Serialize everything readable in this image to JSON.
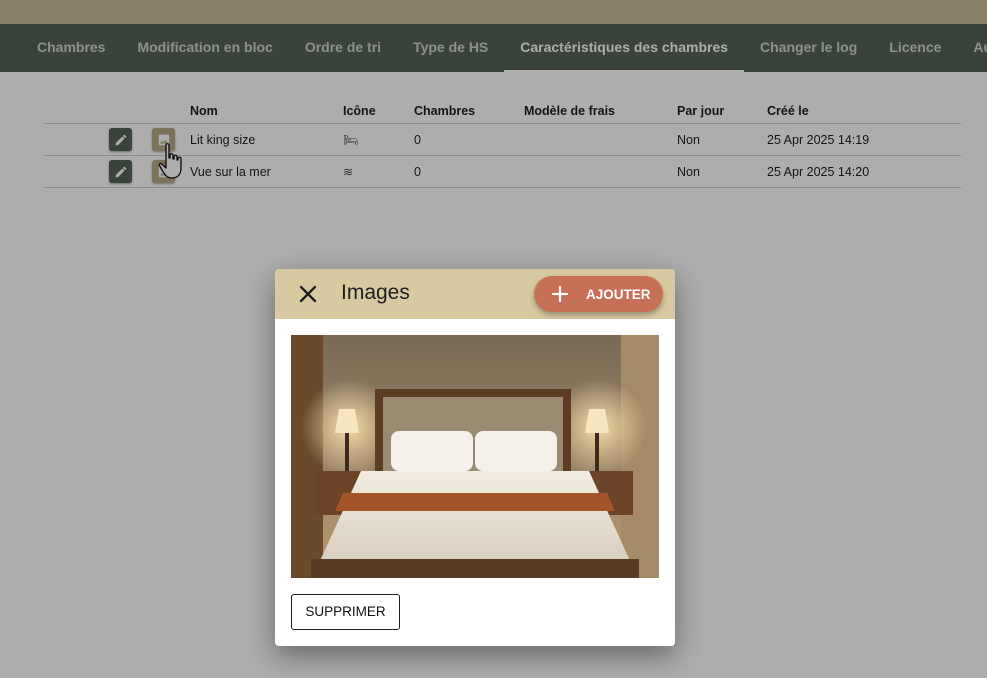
{
  "tabs": [
    {
      "label": "Chambres"
    },
    {
      "label": "Modification en bloc"
    },
    {
      "label": "Ordre de tri"
    },
    {
      "label": "Type de HS"
    },
    {
      "label": "Caractéristiques des chambres"
    },
    {
      "label": "Changer le log"
    },
    {
      "label": "Licence"
    },
    {
      "label": "Autre"
    }
  ],
  "active_tab": "Caractéristiques des chambres",
  "table": {
    "columns": [
      "Nom",
      "Icône",
      "Chambres",
      "Modèle de frais",
      "Par jour",
      "Créé le"
    ],
    "rows": [
      {
        "name": "Lit king size",
        "icon": "bed-icon",
        "icon_glyph": "🛏",
        "rooms": "0",
        "fee_model": "",
        "per_day": "Non",
        "created": "25 Apr 2025 14:19"
      },
      {
        "name": "Vue sur la mer",
        "icon": "waves-icon",
        "icon_glyph": "≋",
        "rooms": "0",
        "fee_model": "",
        "per_day": "Non",
        "created": "25 Apr 2025 14:20"
      }
    ]
  },
  "dialog": {
    "title": "Images",
    "add_label": "AJOUTER",
    "delete_label": "SUPPRIMER",
    "image_description": "hotel-bedroom-photo"
  },
  "colors": {
    "header_band": "#cbbf9c",
    "tab_bar": "#566455",
    "edit_button": "#566455",
    "image_button": "#b7a883",
    "dialog_header": "#d8c9a1",
    "add_button": "#c86f58"
  }
}
